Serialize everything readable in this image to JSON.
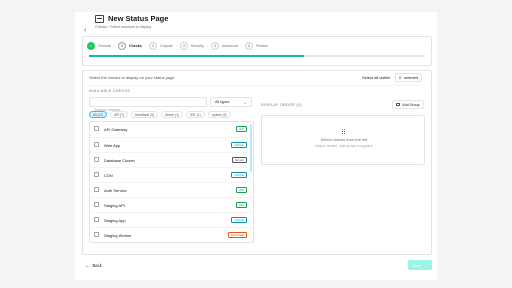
{
  "header": {
    "back_icon": "chevron-left-icon",
    "title_icon": "status-page-icon",
    "title": "New Status Page",
    "subtitle": "Checks › Select monitors to display"
  },
  "steps": [
    {
      "number": "✓",
      "label": "General",
      "state": "done"
    },
    {
      "number": "2",
      "label": "Checks",
      "state": "active"
    },
    {
      "number": "3",
      "label": "Outputs",
      "state": "pending"
    },
    {
      "number": "4",
      "label": "Security",
      "state": "pending"
    },
    {
      "number": "5",
      "label": "Advanced",
      "state": "pending"
    },
    {
      "number": "6",
      "label": "Review",
      "state": "pending"
    }
  ],
  "step_separator": "›",
  "progress": {
    "fraction": 0.64,
    "color": "#14b8a6"
  },
  "instructions": "Select the checks to display on your status page",
  "select_all_label": "Select all visible",
  "selected": {
    "count": "0",
    "label": "selected"
  },
  "available": {
    "section_label": "AVAILABLE CHECKS",
    "search_placeholder": "Search checks...",
    "type_select_value": "All types",
    "filters": [
      {
        "label": "All (12)",
        "active": true
      },
      {
        "label": "API (7)",
        "active": false
      },
      {
        "label": "Heartbeat (3)",
        "active": false
      },
      {
        "label": "Server (1)",
        "active": false
      },
      {
        "label": "SSL (1)",
        "active": false
      },
      {
        "label": "Uptime (0)",
        "active": false
      }
    ],
    "checks": [
      {
        "name": "API Gateway",
        "type": "API",
        "color": "#16a34a"
      },
      {
        "name": "Web App",
        "type": "Uptime",
        "color": "#0891b2"
      },
      {
        "name": "Database Cluster",
        "type": "Server",
        "color": "#52525b"
      },
      {
        "name": "CDN",
        "type": "Uptime",
        "color": "#0891b2"
      },
      {
        "name": "Auth Service",
        "type": "API",
        "color": "#16a34a"
      },
      {
        "name": "Staging API",
        "type": "API",
        "color": "#16a34a"
      },
      {
        "name": "Staging App",
        "type": "Uptime",
        "color": "#0891b2"
      },
      {
        "name": "Staging Worker",
        "type": "Heartbeat",
        "color": "#ea580c"
      }
    ]
  },
  "display_order": {
    "section_label": "DISPLAY ORDER (0)",
    "add_group_label": "Add Group",
    "empty_icon": "drag-handle-icon",
    "empty_title": "Select checks from the left",
    "empty_hint": "Drag to reorder · Add groups to organize"
  },
  "footer": {
    "back_label": "Back",
    "next_label": "Next"
  }
}
